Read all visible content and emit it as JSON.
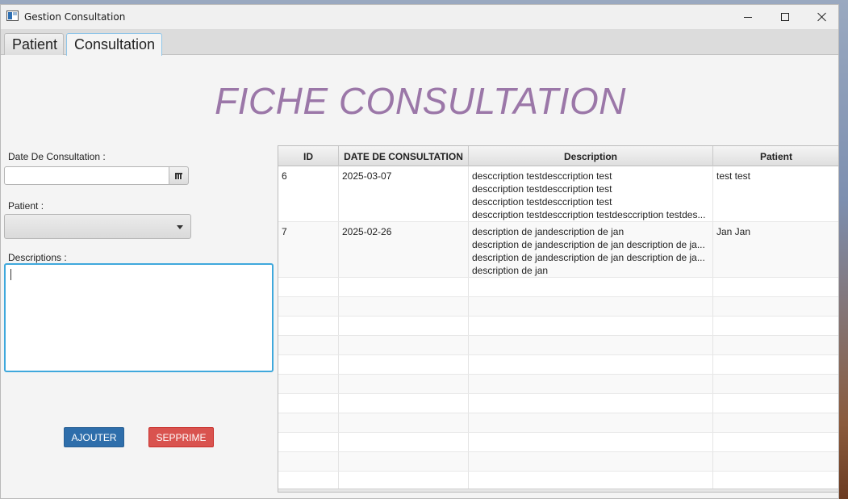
{
  "window": {
    "title": "Gestion Consultation",
    "icons": {
      "app": "app-icon",
      "minimize": "minimize-icon",
      "maximize": "maximize-icon",
      "close": "close-icon"
    }
  },
  "tabs": [
    {
      "label": "Patient",
      "selected": false
    },
    {
      "label": "Consultation",
      "selected": true
    }
  ],
  "heading": "FICHE CONSULTATION",
  "form": {
    "date_label": "Date De Consultation :",
    "date_value": "",
    "date_icon": "calendar-icon",
    "patient_label": "Patient :",
    "patient_value": "",
    "patient_icon": "chevron-down-icon",
    "description_label": "Descriptions :",
    "description_value": ""
  },
  "buttons": {
    "add": "AJOUTER",
    "delete": "SEPPRIME"
  },
  "colors": {
    "heading": "#9b77a8",
    "add_button": "#2e6eab",
    "delete_button": "#d9534f",
    "focus_border": "#3fa8dc"
  },
  "table": {
    "columns": [
      "ID",
      "DATE DE CONSULTATION",
      "Description",
      "Patient"
    ],
    "rows": [
      {
        "id": "6",
        "date": "2025-03-07",
        "description": [
          "desccription testdesccription test",
          "desccription testdesccription test",
          "desccription testdesccription test",
          "desccription testdesccription testdesccription testdes..."
        ],
        "patient": "test test"
      },
      {
        "id": "7",
        "date": "2025-02-26",
        "description": [
          "description de jandescription de jan",
          "description de jandescription de jan description de ja...",
          "description de jandescription de jan description de ja...",
          "description de jan"
        ],
        "patient": "Jan Jan"
      }
    ]
  }
}
